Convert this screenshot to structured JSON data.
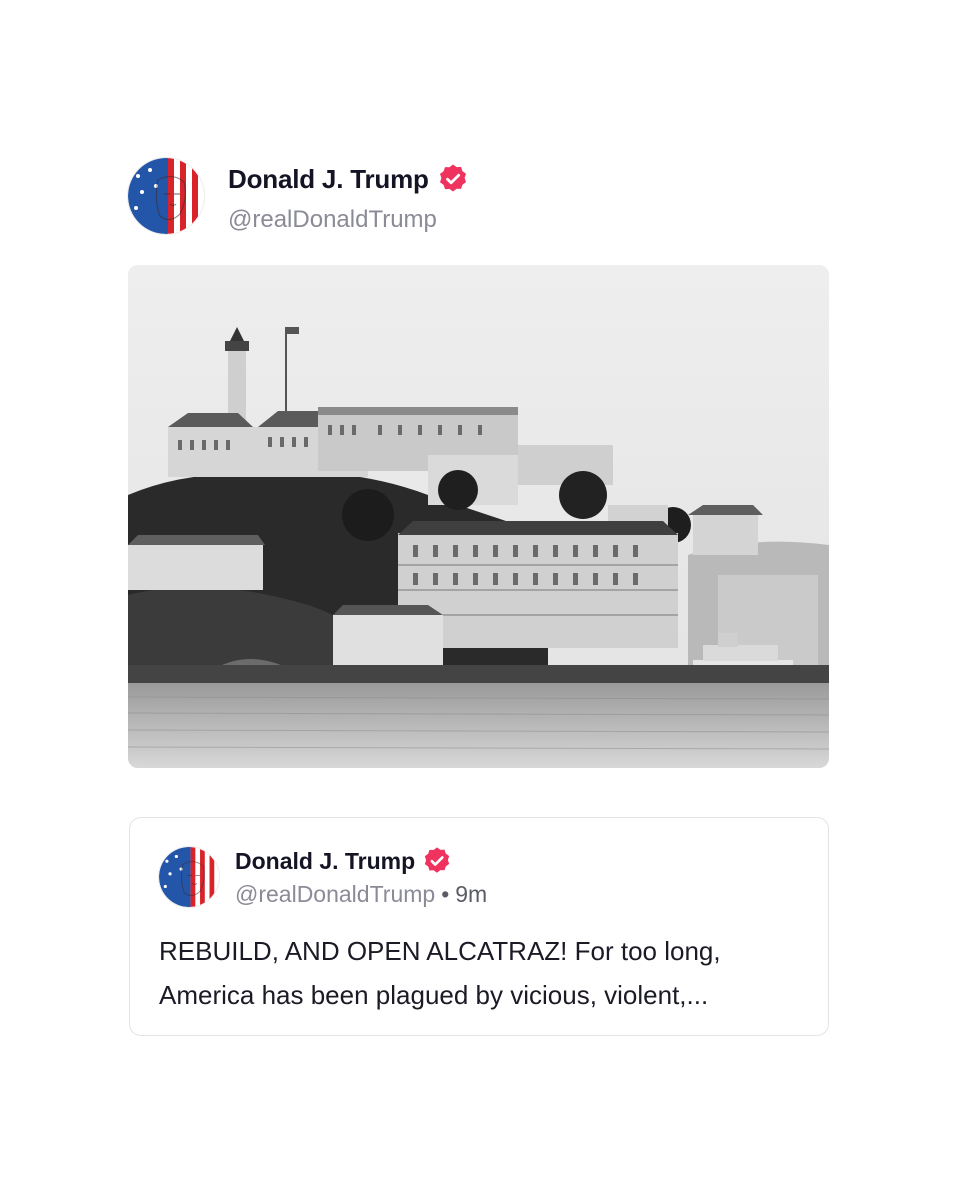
{
  "post": {
    "author": {
      "name": "Donald J. Trump",
      "handle": "@realDonaldTrump",
      "verified": true,
      "avatar_icon": "flag-face-avatar",
      "verified_icon": "verified-badge-icon"
    },
    "media": {
      "type": "photo",
      "description": "black-and-white photo of Alcatraz island"
    }
  },
  "quote": {
    "author": {
      "name": "Donald J. Trump",
      "handle": "@realDonaldTrump",
      "verified": true
    },
    "separator": "•",
    "time": "9m",
    "text": "REBUILD, AND OPEN ALCATRAZ! For too long, America has been plagued by vicious, violent,..."
  },
  "colors": {
    "verified_badge": "#f0325e",
    "handle_text": "#8a8b96",
    "card_border": "#e3e3e8"
  }
}
